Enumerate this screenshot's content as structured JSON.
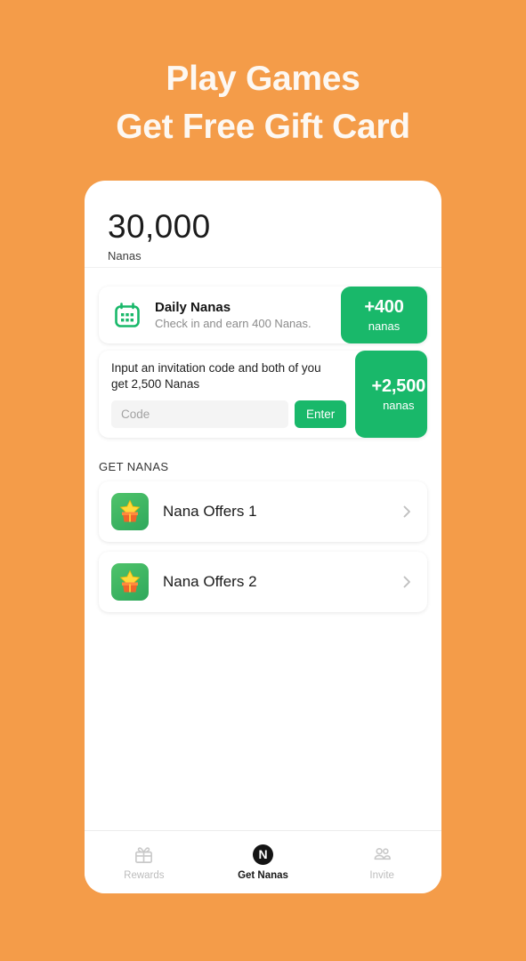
{
  "hero": {
    "line1": "Play Games",
    "line2": "Get Free Gift Card"
  },
  "colors": {
    "background": "#f49c49",
    "accent_green": "#19b86a",
    "card_white": "#ffffff",
    "active_tab": "#181818",
    "inactive_tab": "#bdbdbd"
  },
  "balance": {
    "amount": "30,000",
    "label": "Nanas"
  },
  "daily": {
    "icon": "calendar-icon",
    "title": "Daily Nanas",
    "subtitle": "Check in and earn 400 Nanas.",
    "reward_value": "+400",
    "reward_unit": "nanas"
  },
  "invite": {
    "description": "Input an invitation code and both of you get 2,500 Nanas",
    "input_placeholder": "Code",
    "input_value": "",
    "submit_label": "Enter",
    "reward_value": "+2,500",
    "reward_unit": "nanas"
  },
  "get_nanas": {
    "section_title": "GET NANAS",
    "offers": [
      {
        "icon": "star-gift-icon",
        "label": "Nana Offers 1",
        "chevron": "chevron-right-icon"
      },
      {
        "icon": "star-gift-icon",
        "label": "Nana Offers 2",
        "chevron": "chevron-right-icon"
      }
    ]
  },
  "tab_bar": {
    "tabs": [
      {
        "icon": "gift-icon",
        "label": "Rewards",
        "active": false
      },
      {
        "icon": "nana-logo-icon",
        "label": "Get Nanas",
        "active": true
      },
      {
        "icon": "people-icon",
        "label": "Invite",
        "active": false
      }
    ]
  }
}
